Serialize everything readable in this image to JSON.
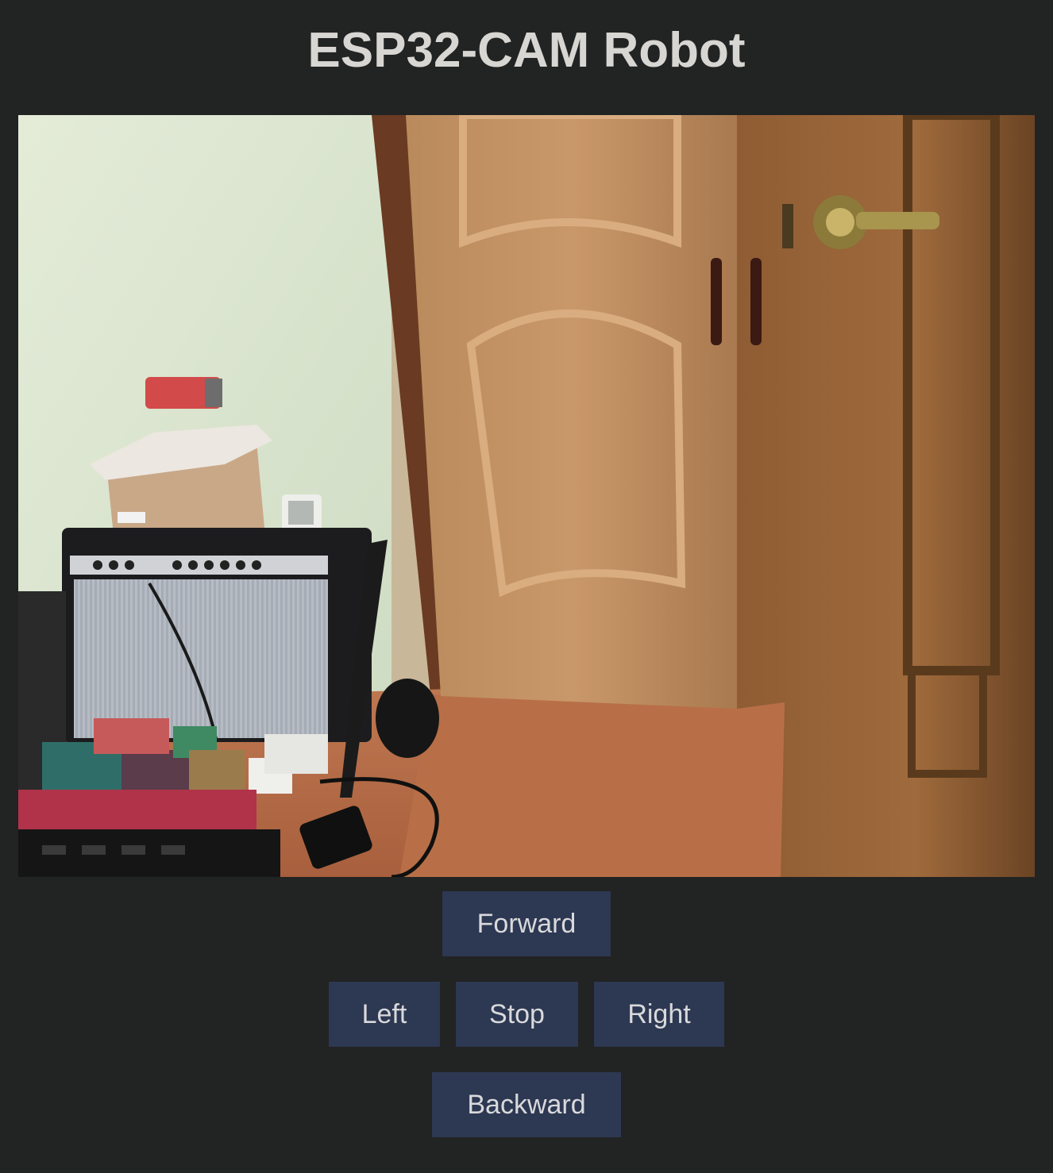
{
  "page": {
    "title": "ESP32-CAM Robot"
  },
  "stream": {
    "description_icon": "camera-stream"
  },
  "controls": {
    "forward_label": "Forward",
    "left_label": "Left",
    "stop_label": "Stop",
    "right_label": "Right",
    "backward_label": "Backward"
  },
  "colors": {
    "background": "#222323",
    "button": "#2d3852",
    "button_text": "#d9d9dc",
    "title_text": "#d8d6d2"
  }
}
